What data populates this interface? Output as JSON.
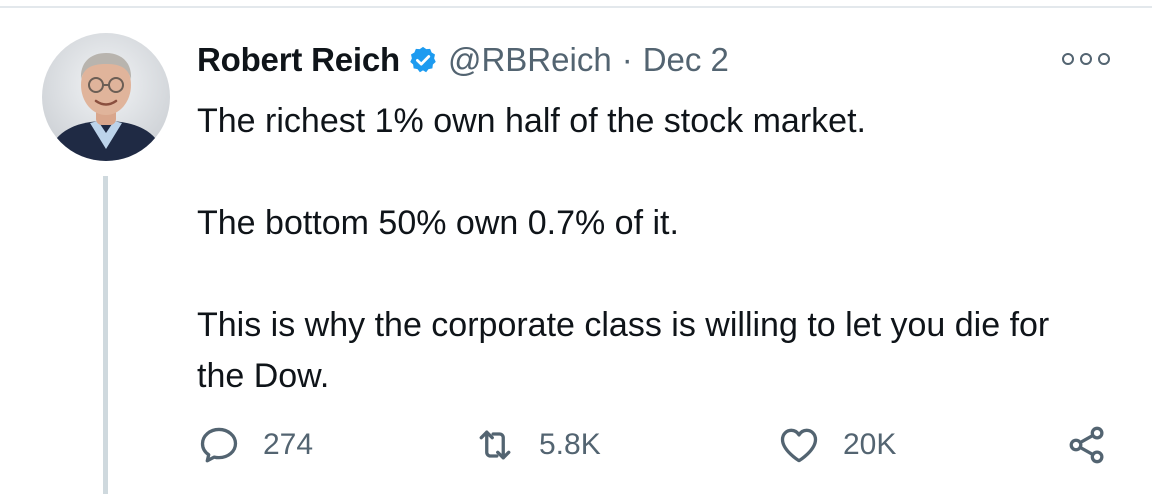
{
  "tweet": {
    "author": {
      "name": "Robert Reich",
      "handle": "@RBReich",
      "verified": true,
      "avatar_icon": "profile-photo"
    },
    "separator": "·",
    "date": "Dec 2",
    "text": {
      "p1": "The richest 1% own half of the stock market.",
      "p2": "The bottom 50% own 0.7% of it.",
      "p3": "This is why the corporate class is willing to let you die for the Dow."
    },
    "actions": {
      "reply": {
        "icon": "reply-icon",
        "count": "274"
      },
      "retweet": {
        "icon": "retweet-icon",
        "count": "5.8K"
      },
      "like": {
        "icon": "heart-icon",
        "count": "20K"
      },
      "share": {
        "icon": "share-icon"
      }
    },
    "more_icon": "more-options-icon"
  },
  "colors": {
    "text_primary": "#0f1419",
    "text_secondary": "#536471",
    "verified_blue": "#1d9bf0",
    "divider": "#e3e8ec",
    "thread_line": "#cfd9de"
  }
}
